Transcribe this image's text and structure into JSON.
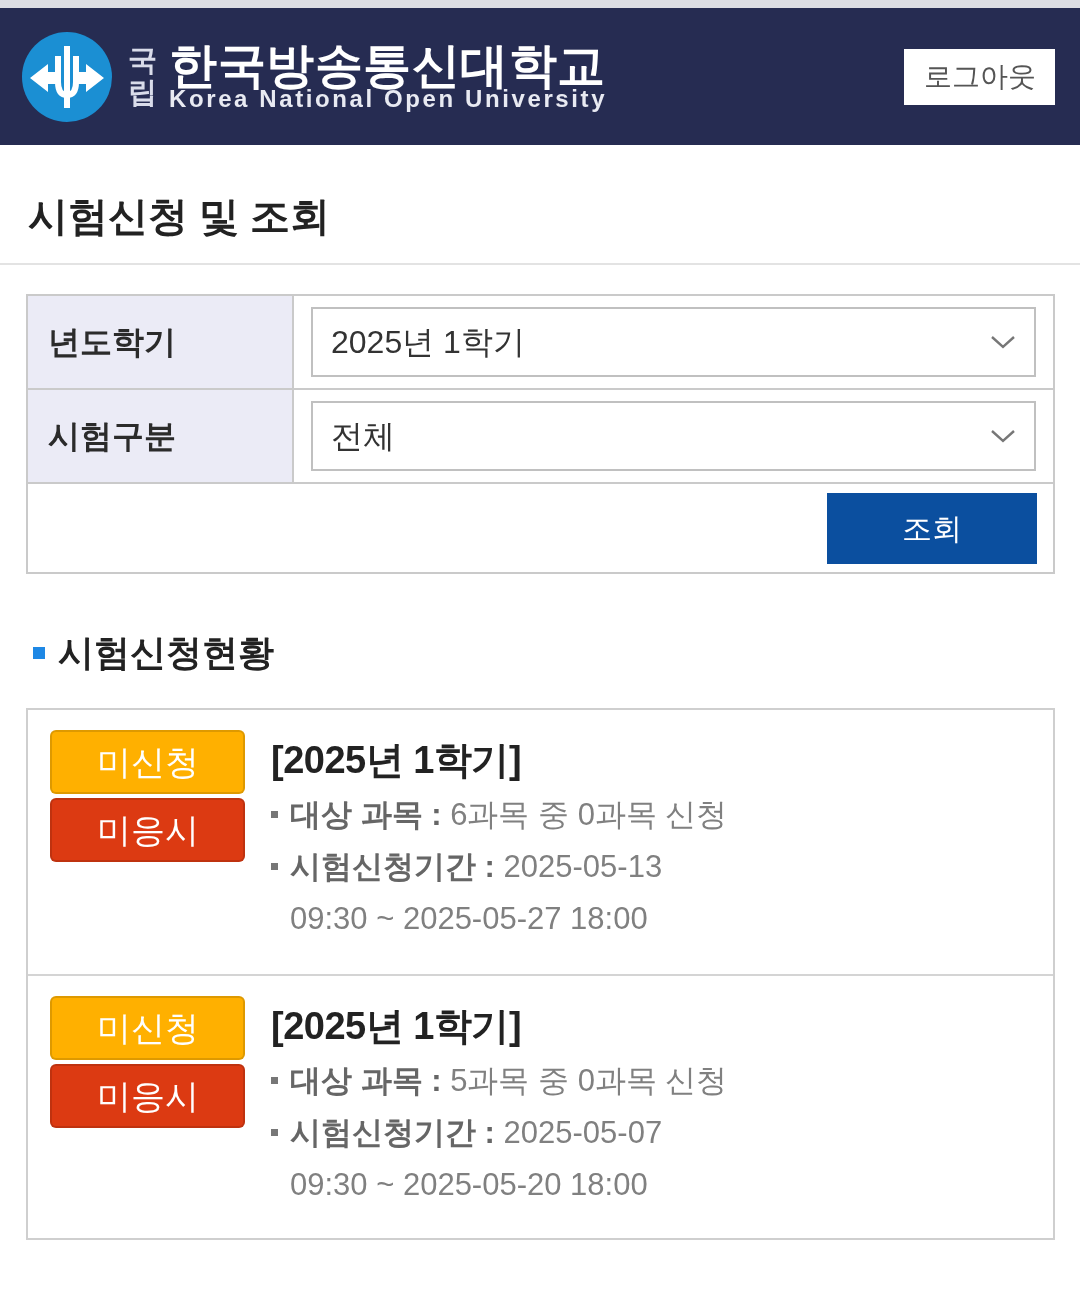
{
  "header": {
    "logo": {
      "prefix": "국립",
      "name": "한국방송통신대학교",
      "name_en": "Korea National Open University"
    },
    "logout_button": "로그아웃"
  },
  "page_title": "시험신청 및 조회",
  "search_form": {
    "fields": [
      {
        "label": "년도학기",
        "value": "2025년 1학기"
      },
      {
        "label": "시험구분",
        "value": "전체"
      }
    ],
    "search_button": "조회"
  },
  "section_title": "시험신청현황",
  "exam_list": [
    {
      "badges": [
        {
          "label": "미신청",
          "color": "#ffb000"
        },
        {
          "label": "미응시",
          "color": "#dc3a12"
        }
      ],
      "title": "[2025년 1학기]",
      "details": [
        {
          "label": "대상 과목 :",
          "value": "6과목 중 0과목 신청"
        },
        {
          "label": "시험신청기간 :",
          "value": "2025-05-13 09:30 ~ 2025-05-27 18:00"
        }
      ]
    },
    {
      "badges": [
        {
          "label": "미신청",
          "color": "#ffb000"
        },
        {
          "label": "미응시",
          "color": "#dc3a12"
        }
      ],
      "title": "[2025년 1학기]",
      "details": [
        {
          "label": "대상 과목 :",
          "value": "5과목 중 0과목 신청"
        },
        {
          "label": "시험신청기간 :",
          "value": "2025-05-07 09:30 ~ 2025-05-20 18:00"
        }
      ]
    }
  ]
}
